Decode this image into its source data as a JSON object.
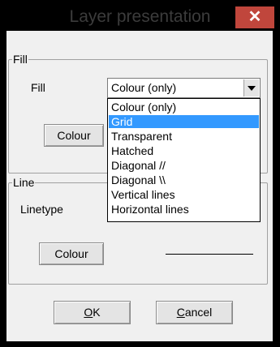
{
  "window": {
    "title": "Layer presentation",
    "close_glyph": "✕"
  },
  "fill_group": {
    "legend": "Fill",
    "fill_label": "Fill",
    "fill_value": "Colour (only)",
    "colour_button": "Colour",
    "dropdown_options": [
      "Colour (only)",
      "Grid",
      "Transparent",
      "Hatched",
      "Diagonal //",
      "Diagonal \\\\",
      "Vertical lines",
      "Horizontal lines"
    ],
    "selected_option": "Grid"
  },
  "line_group": {
    "legend": "Line",
    "linetype_label": "Linetype",
    "colour_button": "Colour"
  },
  "buttons": {
    "ok_accel": "O",
    "ok_rest": "K",
    "cancel_accel": "C",
    "cancel_rest": "ancel"
  },
  "colors": {
    "title_bar": "#000000",
    "close_button": "#c0463c",
    "selection": "#3399ff",
    "dialog_bg": "#f0f0f0"
  },
  "icons": {
    "close": "close-icon",
    "dropdown": "chevron-down-icon"
  }
}
